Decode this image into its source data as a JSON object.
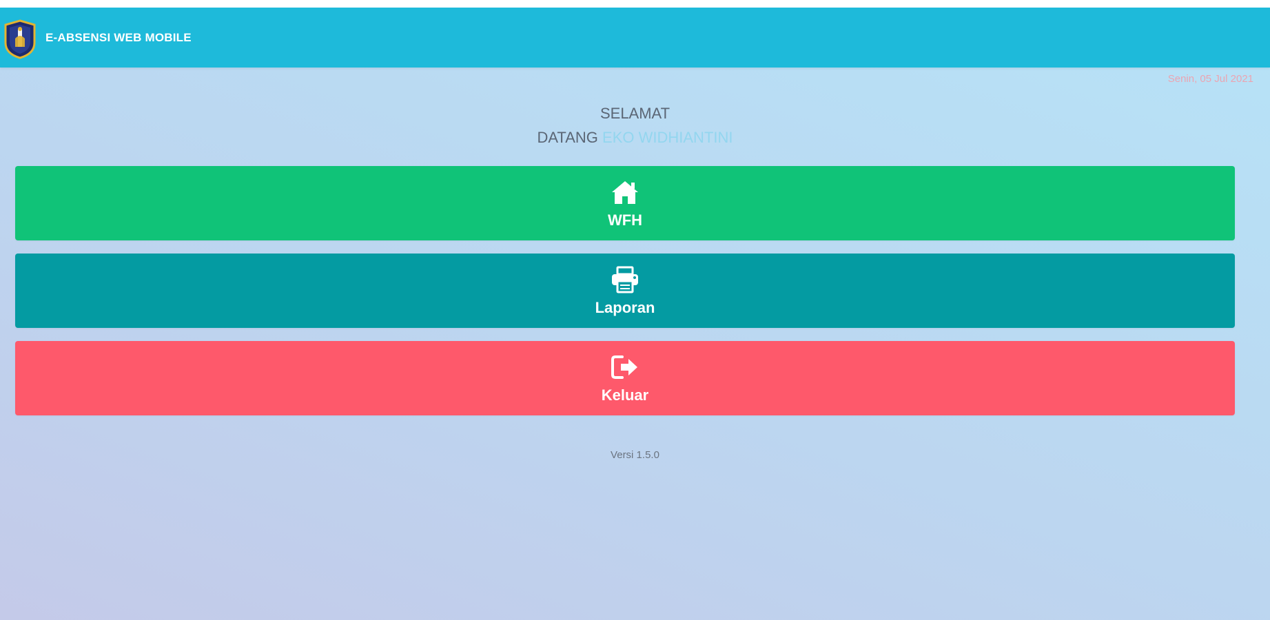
{
  "header": {
    "app_title": "E-ABSENSI WEB MOBILE",
    "logo_icon": "crest-emblem-icon",
    "background_color": "#1ebada"
  },
  "date_text": "Senin, 05 Jul 2021",
  "welcome": {
    "line1": "SELAMAT",
    "line2": "DATANG",
    "user_name": "EKO WIDHIANTINI"
  },
  "menu": [
    {
      "label": "WFH",
      "icon": "home-icon",
      "color": "#10c378"
    },
    {
      "label": "Laporan",
      "icon": "printer-icon",
      "color": "#049ba2"
    },
    {
      "label": "Keluar",
      "icon": "sign-out-icon",
      "color": "#fe596b"
    }
  ],
  "footer": {
    "version": "Versi 1.5.0"
  }
}
